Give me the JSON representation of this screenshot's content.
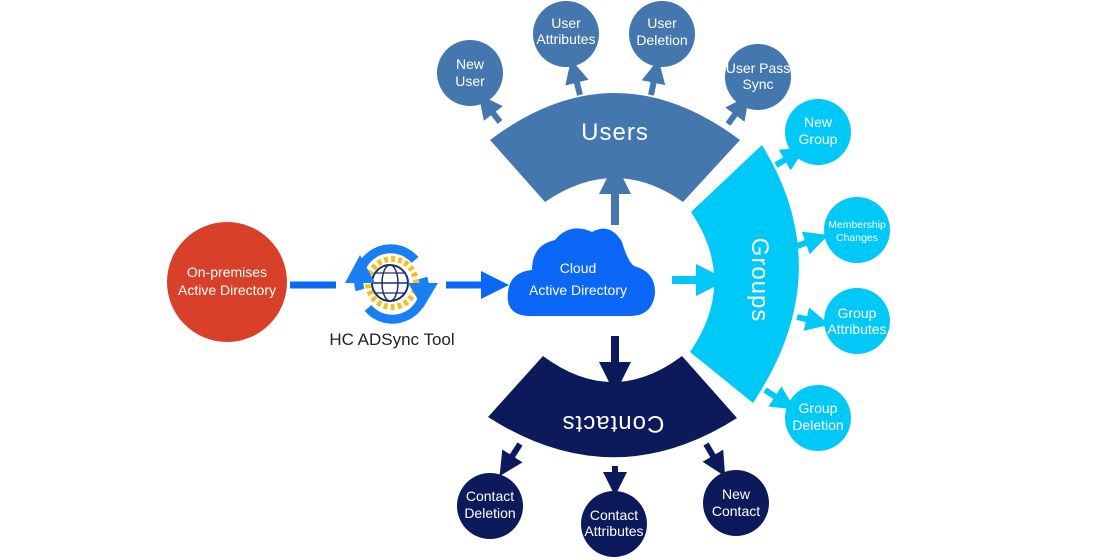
{
  "colors": {
    "users": "#4377ad",
    "groups": "#00c8f7",
    "contacts": "#0c1a5b",
    "cloud": "#0b67f6",
    "on_premises": "#d8402a",
    "sync_arrows": "#1a7ff0",
    "gear": "#f4c020"
  },
  "source": {
    "line1": "On-premises",
    "line2": "Active Directory"
  },
  "tool": {
    "label": "HC ADSync Tool",
    "icon": "sync-gear-globe-icon"
  },
  "cloud": {
    "line1": "Cloud",
    "line2": "Active Directory"
  },
  "users": {
    "label": "Users",
    "items": [
      {
        "line1": "New",
        "line2": "User"
      },
      {
        "line1": "User",
        "line2": "Attributes"
      },
      {
        "line1": "User",
        "line2": "Deletion"
      },
      {
        "line1": "User Pass",
        "line2": "Sync"
      }
    ]
  },
  "groups": {
    "label": "Groups",
    "items": [
      {
        "line1": "New",
        "line2": "Group"
      },
      {
        "line1": "Membership",
        "line2": "Changes"
      },
      {
        "line1": "Group",
        "line2": "Attributes"
      },
      {
        "line1": "Group",
        "line2": "Deletion"
      }
    ]
  },
  "contacts": {
    "label": "Contacts",
    "items": [
      {
        "line1": "Contact",
        "line2": "Deletion"
      },
      {
        "line1": "Contact",
        "line2": "Attributes"
      },
      {
        "line1": "New",
        "line2": "Contact"
      }
    ]
  }
}
